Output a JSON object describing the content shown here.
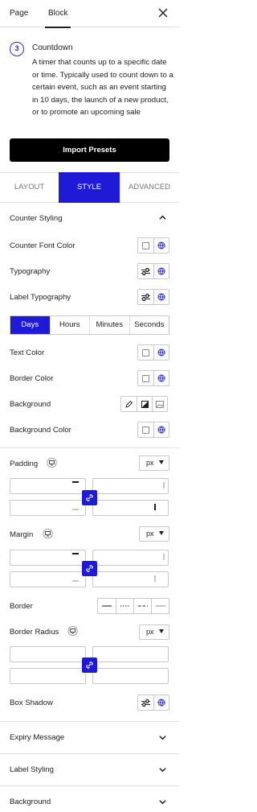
{
  "topbar": {
    "tabs": [
      "Page",
      "Block"
    ],
    "active": "Block"
  },
  "block": {
    "title": "Countdown",
    "icon_glyph": "3",
    "description": "A timer that counts up to a specific date or time. Typically used to count down to a certain event, such as an event starting in 10 days, the launch of a new product, or to promote an upcoming sale"
  },
  "import_label": "Import Presets",
  "panel_tabs": [
    "LAYOUT",
    "STYLE",
    "ADVANCED"
  ],
  "active_tab": "STYLE",
  "counter_styling": {
    "title": "Counter Styling",
    "font_color": "Counter Font Color",
    "typography": "Typography",
    "label_typography": "Label Typography",
    "units": [
      "Days",
      "Hours",
      "Minutes",
      "Seconds"
    ],
    "active_unit": "Days",
    "text_color": "Text Color",
    "border_color": "Border Color",
    "background": "Background",
    "background_color": "Background Color",
    "padding": "Padding",
    "margin": "Margin",
    "border": "Border",
    "border_radius": "Border Radius",
    "box_shadow": "Box Shadow",
    "unit_value": "px"
  },
  "accordions": [
    "Expiry Message",
    "Label Styling",
    "Background"
  ],
  "colors": {
    "accent": "#1e1ad6",
    "text": "#1e1e1e",
    "border": "#c8c8c8"
  }
}
